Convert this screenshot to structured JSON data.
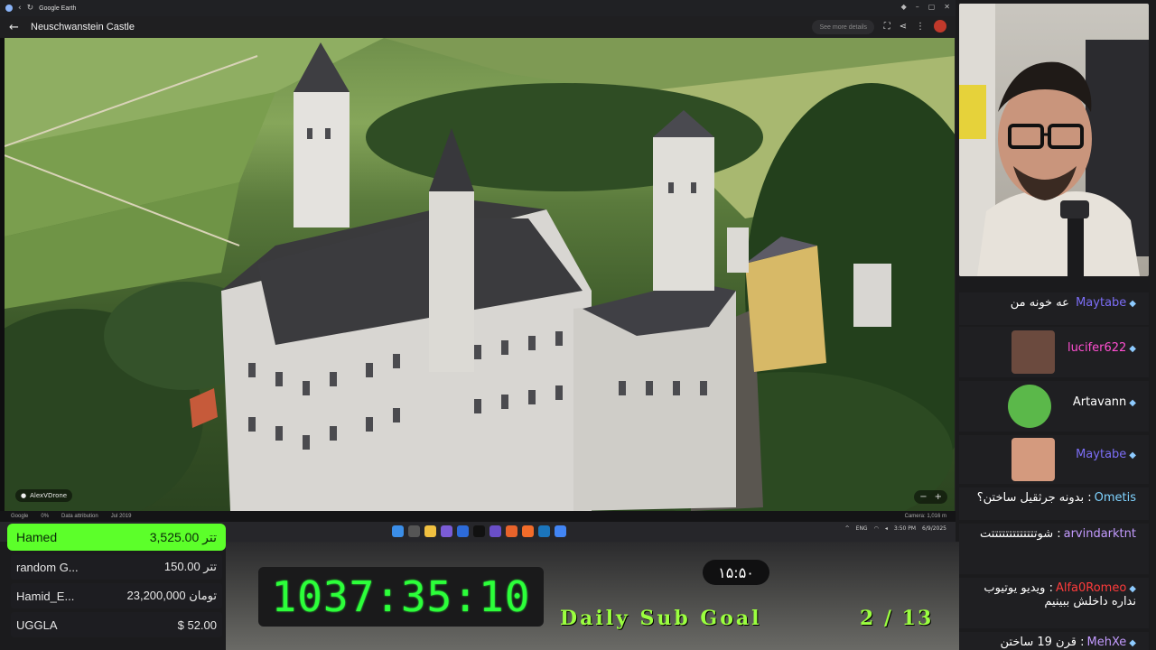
{
  "browser": {
    "tab_title": "Google Earth",
    "place_title": "Neuschwanstein Castle",
    "see_more": "See more details",
    "footer_brand": "Google",
    "footer_pct": "0%",
    "footer_attrib": "Data attribution",
    "footer_date": "Jul 2019",
    "footer_camera": "Camera: 1,016 m",
    "credit": "AlexVDrone",
    "tray_lang": "ENG",
    "tray_time": "3:50 PM",
    "tray_date": "6/9/2025"
  },
  "chat": {
    "messages": [
      {
        "user": "Maytabe",
        "text": "عه خونه من",
        "color": "#7c6ef7"
      },
      {
        "user": "lucifer622",
        "text": "",
        "color": "#ff4fd1"
      },
      {
        "user": "Artavann",
        "text": "",
        "color": "#ffffff"
      },
      {
        "user": "Maytabe",
        "text": "",
        "color": "#7c6ef7"
      },
      {
        "user": "Ometis",
        "text": "بدونه جرثقیل ساختن؟",
        "color": "#7fd3ff"
      },
      {
        "user": "arvindarktnt",
        "text": "شوتتتتتتتتتتتتتت",
        "color": "#c39bff"
      },
      {
        "user": "Alfa0Romeo",
        "text": "ویدیو یوتیوب نداره داخلش ببینیم",
        "color": "#ff3b3b"
      },
      {
        "user": "MehXe",
        "text": "قرن 19 ساختن",
        "color": "#c39bff"
      }
    ]
  },
  "donations": {
    "top": {
      "name": "Hamed",
      "amount": "3,525.00 تتر"
    },
    "rows": [
      {
        "name": "random G...",
        "amount": "150.00 تتر"
      },
      {
        "name": "Hamid_E...",
        "amount": "23,200,000 تومان"
      },
      {
        "name": "UGGLA",
        "amount": "$ 52.00"
      }
    ]
  },
  "stream": {
    "timer": "1037:35:10",
    "clock": "۱۵:۵۰",
    "sub_goal_label": "Daily Sub Goal",
    "sub_goal_count": "2 / 13"
  },
  "colors": {
    "accent_green": "#5cff2a",
    "timer_green": "#2cff3a",
    "goal_green": "#9bff3f"
  }
}
